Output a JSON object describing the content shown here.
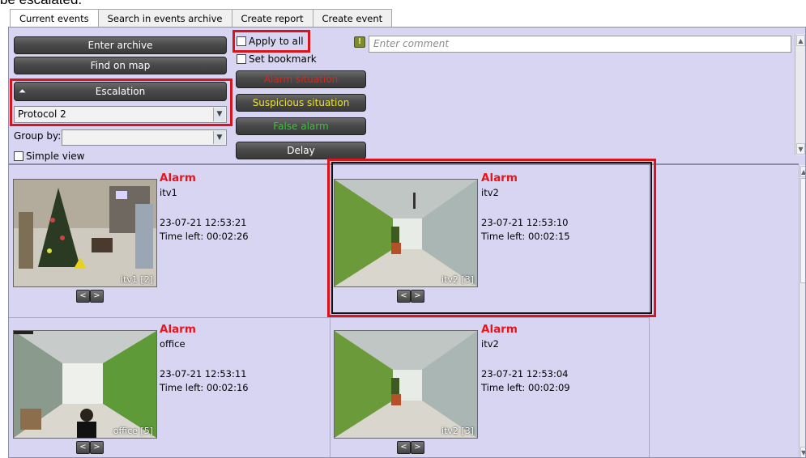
{
  "clipped_caption": "be escalated.",
  "tabs": [
    "Current events",
    "Search in events archive",
    "Create report",
    "Create event"
  ],
  "buttons": {
    "enter_archive": "Enter archive",
    "find_on_map": "Find on map",
    "escalation": "Escalation",
    "alarm_situation": "Alarm situation",
    "suspicious_situation": "Suspicious situation",
    "false_alarm": "False alarm",
    "delay": "Delay"
  },
  "colors": {
    "alarm_situation": "#e2231a",
    "suspicious_situation": "#e9e23b",
    "false_alarm": "#35c53a",
    "alarm_title": "#e8151c",
    "highlight": "#d8141c"
  },
  "protocol_select": "Protocol 2",
  "group_by": {
    "label": "Group by:",
    "value": ""
  },
  "checkboxes": {
    "simple_view": "Simple view",
    "apply_to_all": "Apply to all",
    "set_bookmark": "Set bookmark"
  },
  "comment": {
    "icon": "hint-icon",
    "placeholder": "Enter comment"
  },
  "events": [
    {
      "title": "Alarm",
      "camera": "itv1",
      "datetime": "23-07-21 12:53:21",
      "time_left": "Time left: 00:02:26",
      "thumb_label": "itv1 [2]"
    },
    {
      "title": "Alarm",
      "camera": "itv2",
      "datetime": "23-07-21 12:53:10",
      "time_left": "Time left: 00:02:15",
      "thumb_label": "itv2 [3]"
    },
    {
      "title": "Alarm",
      "camera": "office",
      "datetime": "23-07-21 12:53:11",
      "time_left": "Time left: 00:02:16",
      "thumb_label": "office [5]"
    },
    {
      "title": "Alarm",
      "camera": "itv2",
      "datetime": "23-07-21 12:53:04",
      "time_left": "Time left: 00:02:09",
      "thumb_label": "itv2 [3]"
    }
  ],
  "nav": {
    "prev": "<",
    "next": ">"
  }
}
